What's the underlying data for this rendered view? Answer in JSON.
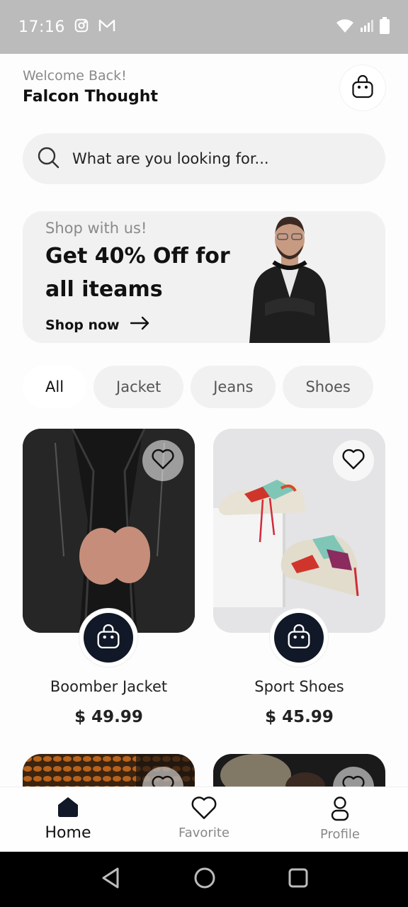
{
  "status_bar": {
    "time": "17:16"
  },
  "header": {
    "welcome": "Welcome Back!",
    "username": "Falcon Thought"
  },
  "search": {
    "placeholder": "What are you looking for..."
  },
  "banner": {
    "subtitle": "Shop with us!",
    "title": "Get 40% Off for all iteams",
    "cta": "Shop now"
  },
  "categories": [
    "All",
    "Jacket",
    "Jeans",
    "Shoes"
  ],
  "products": [
    {
      "name": "Boomber Jacket",
      "price": "$ 49.99"
    },
    {
      "name": "Sport Shoes",
      "price": "$ 45.99"
    }
  ],
  "bottom_nav": {
    "home": "Home",
    "favorite": "Favorite",
    "profile": "Profile"
  },
  "colors": {
    "accent": "#111827",
    "surface": "#f1f1f1",
    "muted_text": "#8a8a8a"
  }
}
